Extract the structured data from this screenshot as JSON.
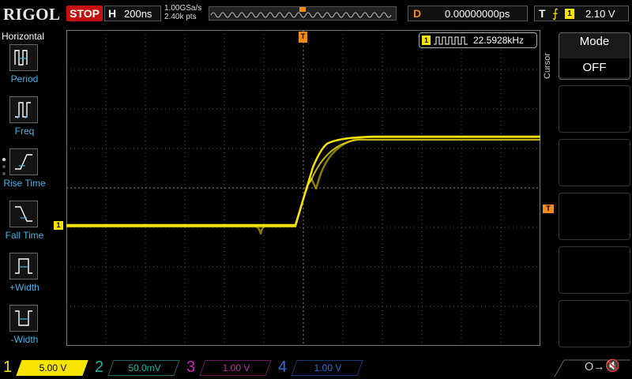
{
  "brand": "RIGOL",
  "run_state": "STOP",
  "timebase": {
    "key": "H",
    "value": "200ns"
  },
  "sampling": {
    "rate": "1.00GSa/s",
    "points": "2.40k pts"
  },
  "delay": {
    "key": "D",
    "value": "0.00000000ps"
  },
  "trigger": {
    "key": "T",
    "edge_icon": "rising-edge-icon",
    "source": "1",
    "level": "2.10 V"
  },
  "measurement": {
    "channel": "1",
    "icon": "pulse-train-icon",
    "value": "22.5928kHz"
  },
  "left_menu": {
    "title": "Horizontal",
    "items": [
      {
        "label": "Period",
        "icon": "period-icon"
      },
      {
        "label": "Freq",
        "icon": "frequency-icon"
      },
      {
        "label": "Rise Time",
        "icon": "rise-time-icon"
      },
      {
        "label": "Fall Time",
        "icon": "fall-time-icon"
      },
      {
        "label": "+Width",
        "icon": "positive-width-icon"
      },
      {
        "label": "-Width",
        "icon": "negative-width-icon"
      }
    ]
  },
  "right_menu": {
    "side_label": "Cursor",
    "mode_title": "Mode",
    "mode_value": "OFF"
  },
  "markers": {
    "ch1": "1",
    "trigger_top": "T",
    "trigger_right": "T"
  },
  "channels": [
    {
      "num": "1",
      "scale": "5.00 V",
      "color": "#f5e400",
      "active": true
    },
    {
      "num": "2",
      "scale": "50.0mV",
      "color": "#1fb3a3",
      "active": false
    },
    {
      "num": "3",
      "scale": "1.00 V",
      "color": "#c42ab0",
      "active": false
    },
    {
      "num": "4",
      "scale": "1.00 V",
      "color": "#2c6ee0",
      "active": false
    }
  ],
  "colors": {
    "ch1": "#f5e400",
    "trigger": "#f28a1a",
    "accent": "#3fb4e8",
    "stop": "#c41010"
  }
}
